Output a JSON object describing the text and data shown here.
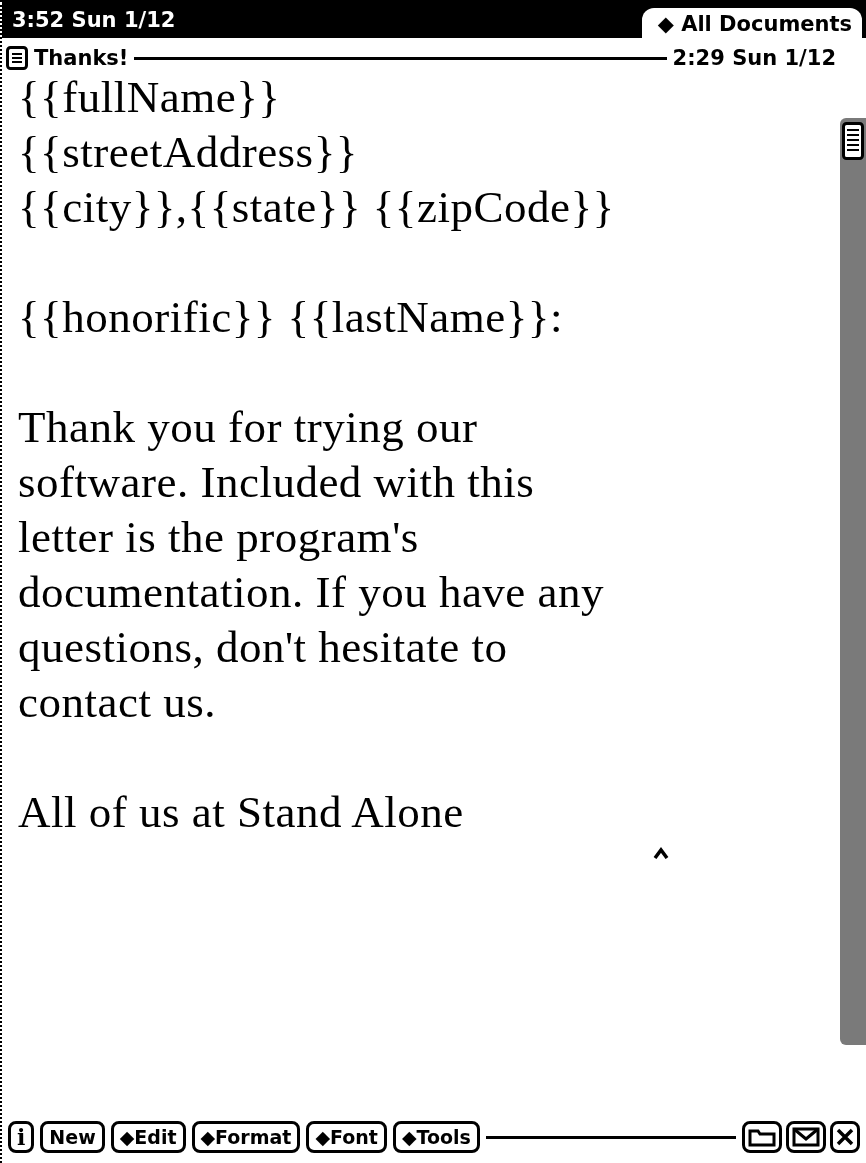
{
  "status_bar": {
    "time": "3:52 Sun 1/12",
    "folder_tab": "◆ All Documents"
  },
  "note": {
    "title": "Thanks!",
    "timestamp": "2:29 Sun 1/12",
    "blocks": [
      {
        "kind": "lines",
        "lines": [
          "{{fullName}}",
          "{{streetAddress}}",
          "{{city}},{{state}} {{zipCode}}"
        ]
      },
      {
        "kind": "lines",
        "lines": [
          "{{honorific}} {{lastName}}:"
        ]
      },
      {
        "kind": "lines",
        "lines": [
          "Thank you for trying our",
          "software. Included with this",
          "letter is the program's",
          "documentation. If you have any",
          "questions, don't hesitate to",
          "contact us."
        ]
      },
      {
        "kind": "lines",
        "lines": [
          "All of us at Stand Alone"
        ]
      }
    ]
  },
  "button_bar": {
    "buttons": [
      {
        "kind": "info",
        "label": "i"
      },
      {
        "kind": "text",
        "label": "New"
      },
      {
        "kind": "text",
        "label": "◆Edit"
      },
      {
        "kind": "text",
        "label": "◆Format"
      },
      {
        "kind": "text",
        "label": "◆Font"
      },
      {
        "kind": "text",
        "label": "◆Tools"
      }
    ],
    "icons": [
      {
        "kind": "folder"
      },
      {
        "kind": "envelope"
      },
      {
        "kind": "close"
      }
    ]
  }
}
